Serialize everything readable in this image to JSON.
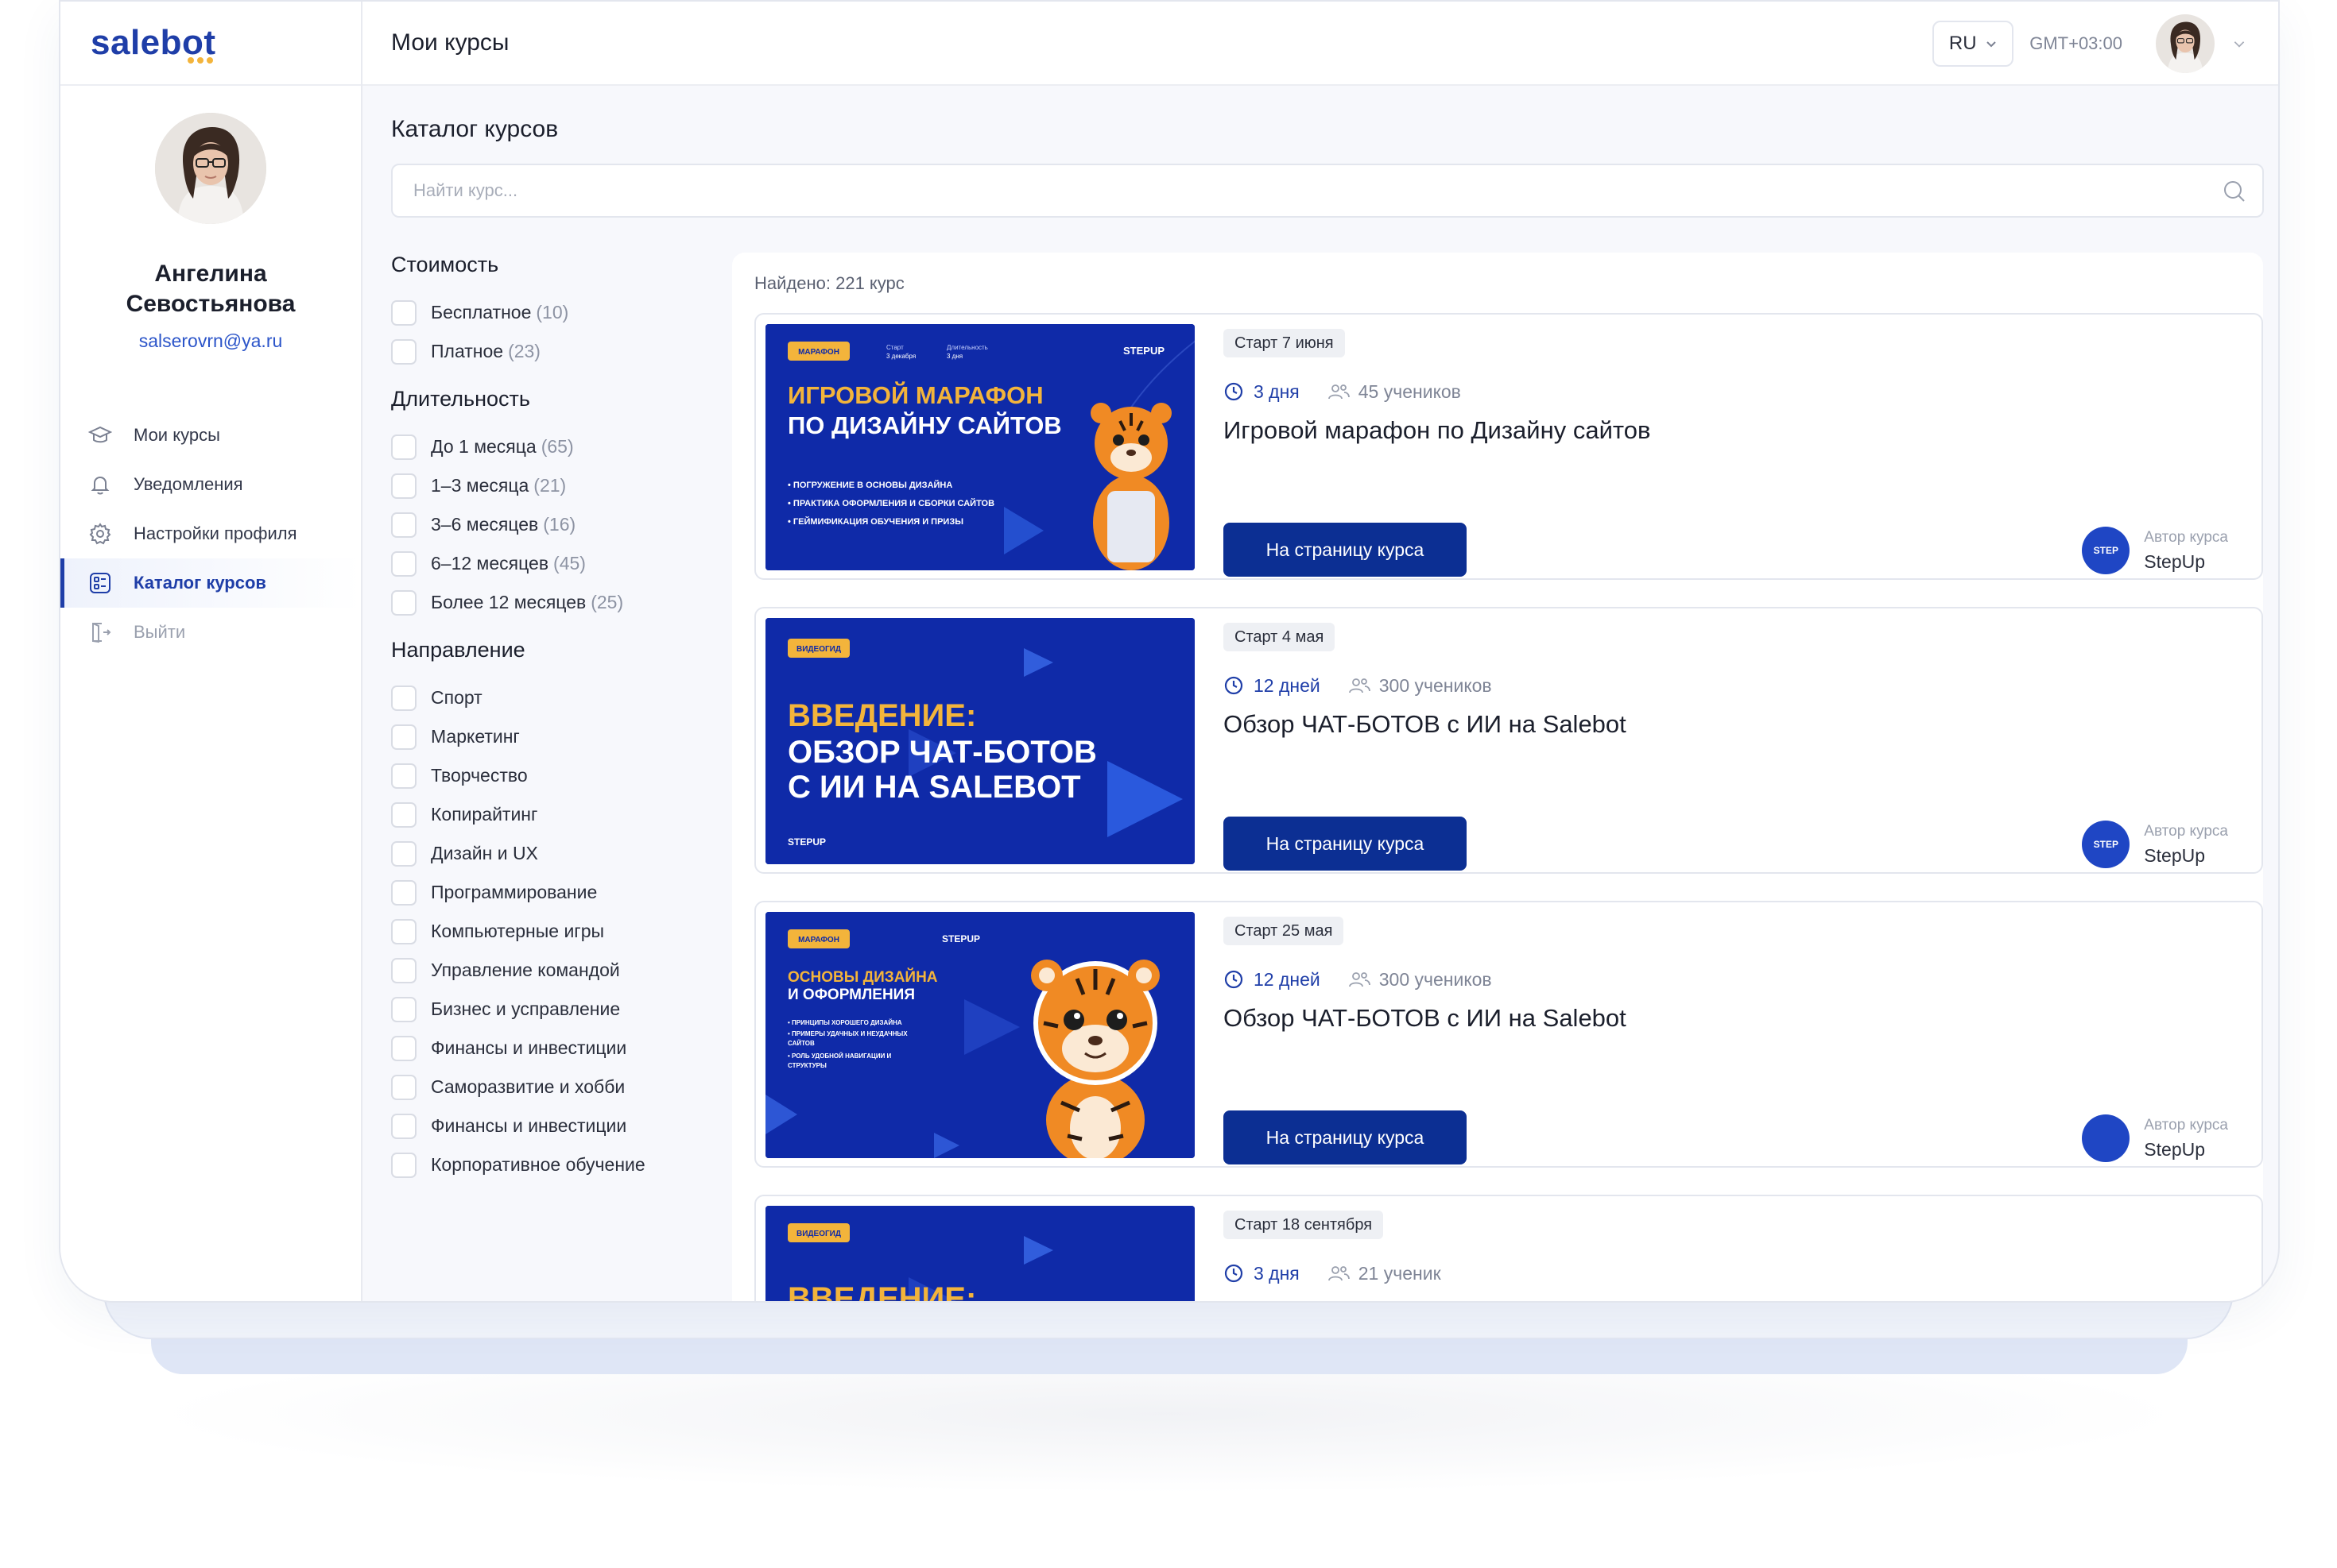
{
  "app": {
    "logo": "salebot"
  },
  "user": {
    "name": "Ангелина Севостьянова",
    "email": "salserovrn@ya.ru"
  },
  "sidebar": {
    "items": [
      {
        "label": "Мои курсы",
        "icon": "graduation-cap-icon"
      },
      {
        "label": "Уведомления",
        "icon": "bell-icon"
      },
      {
        "label": "Настройки профиля",
        "icon": "gear-icon"
      },
      {
        "label": "Каталог курсов",
        "icon": "catalog-grid-icon",
        "active": true
      },
      {
        "label": "Выйти",
        "icon": "logout-icon"
      }
    ]
  },
  "topbar": {
    "title": "Мои курсы",
    "lang": "RU",
    "timezone": "GMT+03:00"
  },
  "catalog": {
    "title": "Каталог курсов",
    "search_placeholder": "Найти курс...",
    "found": "Найдено: 221 курс"
  },
  "filters": [
    {
      "title": "Стоимость",
      "options": [
        {
          "label": "Бесплатное",
          "count": "(10)"
        },
        {
          "label": "Платное",
          "count": "(23)"
        }
      ]
    },
    {
      "title": "Длительность",
      "options": [
        {
          "label": "До 1 месяца",
          "count": "(65)"
        },
        {
          "label": "1–3 месяца",
          "count": "(21)"
        },
        {
          "label": "3–6 месяцев",
          "count": "(16)"
        },
        {
          "label": "6–12 месяцев",
          "count": "(45)"
        },
        {
          "label": "Более 12 месяцев",
          "count": "(25)"
        }
      ]
    },
    {
      "title": "Направление",
      "options": [
        {
          "label": "Спорт"
        },
        {
          "label": "Маркетинг"
        },
        {
          "label": "Творчество"
        },
        {
          "label": "Копирайтинг"
        },
        {
          "label": "Дизайн и UX"
        },
        {
          "label": "Программирование"
        },
        {
          "label": "Компьютерные игры"
        },
        {
          "label": "Управление командой"
        },
        {
          "label": "Бизнес и усправление"
        },
        {
          "label": "Финансы и инвестиции"
        },
        {
          "label": "Саморазвитие и хобби"
        },
        {
          "label": "Финансы и инвестиции"
        },
        {
          "label": "Корпоративное обучение"
        }
      ]
    }
  ],
  "courses": [
    {
      "start": "Старт 7 июня",
      "duration": "3 дня",
      "students": "45 учеников",
      "title": "Игровой марафон по Дизайну сайтов",
      "button": "На страницу курса",
      "author_caption": "Автор курса",
      "author_name": "StepUp",
      "thumb": {
        "tag": "МАРАФОН",
        "brand": "STEPUP",
        "small1": "Старт",
        "small2": "3 декабря",
        "small3": "Длительность",
        "small4": "3 дня",
        "heading1": "ИГРОВОЙ МАРАФОН",
        "heading2": "ПО ДИЗАЙНУ САЙТОВ",
        "bullet1": "• ПОГРУЖЕНИЕ В ОСНОВЫ ДИЗАЙНА",
        "bullet2": "• ПРАКТИКА ОФОРМЛЕНИЯ И СБОРКИ САЙТОВ",
        "bullet3": "• ГЕЙМИФИКАЦИЯ ОБУЧЕНИЯ И ПРИЗЫ"
      }
    },
    {
      "start": "Старт 4 мая",
      "duration": "12 дней",
      "students": "300 учеников",
      "title": "Обзор ЧАТ-БОТОВ с ИИ на Salebot",
      "button": "На страницу курса",
      "author_caption": "Автор курса",
      "author_name": "StepUp",
      "thumb": {
        "tag": "ВИДЕОГИД",
        "brand": "STEPUP",
        "heading1": "ВВЕДЕНИЕ:",
        "heading2": "ОБЗОР ЧАТ-БОТОВ",
        "heading3": "С ИИ НА SALEBOT"
      }
    },
    {
      "start": "Старт 25 мая",
      "duration": "12 дней",
      "students": "300 учеников",
      "title": "Обзор ЧАТ-БОТОВ с ИИ на Salebot",
      "button": "На страницу курса",
      "author_caption": "Автор курса",
      "author_name": "StepUp",
      "thumb": {
        "tag": "МАРАФОН",
        "brand": "STEPUP",
        "heading1": "ОСНОВЫ ДИЗАЙНА",
        "heading2": "И ОФОРМЛЕНИЯ",
        "bullet1": "• ПРИНЦИПЫ ХОРОШЕГО ДИЗАЙНА",
        "bullet2": "• ПРИМЕРЫ УДАЧНЫХ И НЕУДАЧНЫХ",
        "bullet3": "  САЙТОВ",
        "bullet4": "• РОЛЬ УДОБНОЙ НАВИГАЦИИ И",
        "bullet5": "  СТРУКТУРЫ"
      }
    },
    {
      "start": "Старт 18 сентября",
      "duration": "3 дня",
      "students": "21 ученик",
      "thumb": {
        "tag": "ВИДЕОГИД",
        "heading1": "ВВЕДЕНИЕ:"
      }
    }
  ],
  "colors": {
    "primary": "#0c2f93",
    "accent": "#1f3ea8",
    "banner": "#0f2aa8",
    "highlight": "#f3b43b"
  }
}
